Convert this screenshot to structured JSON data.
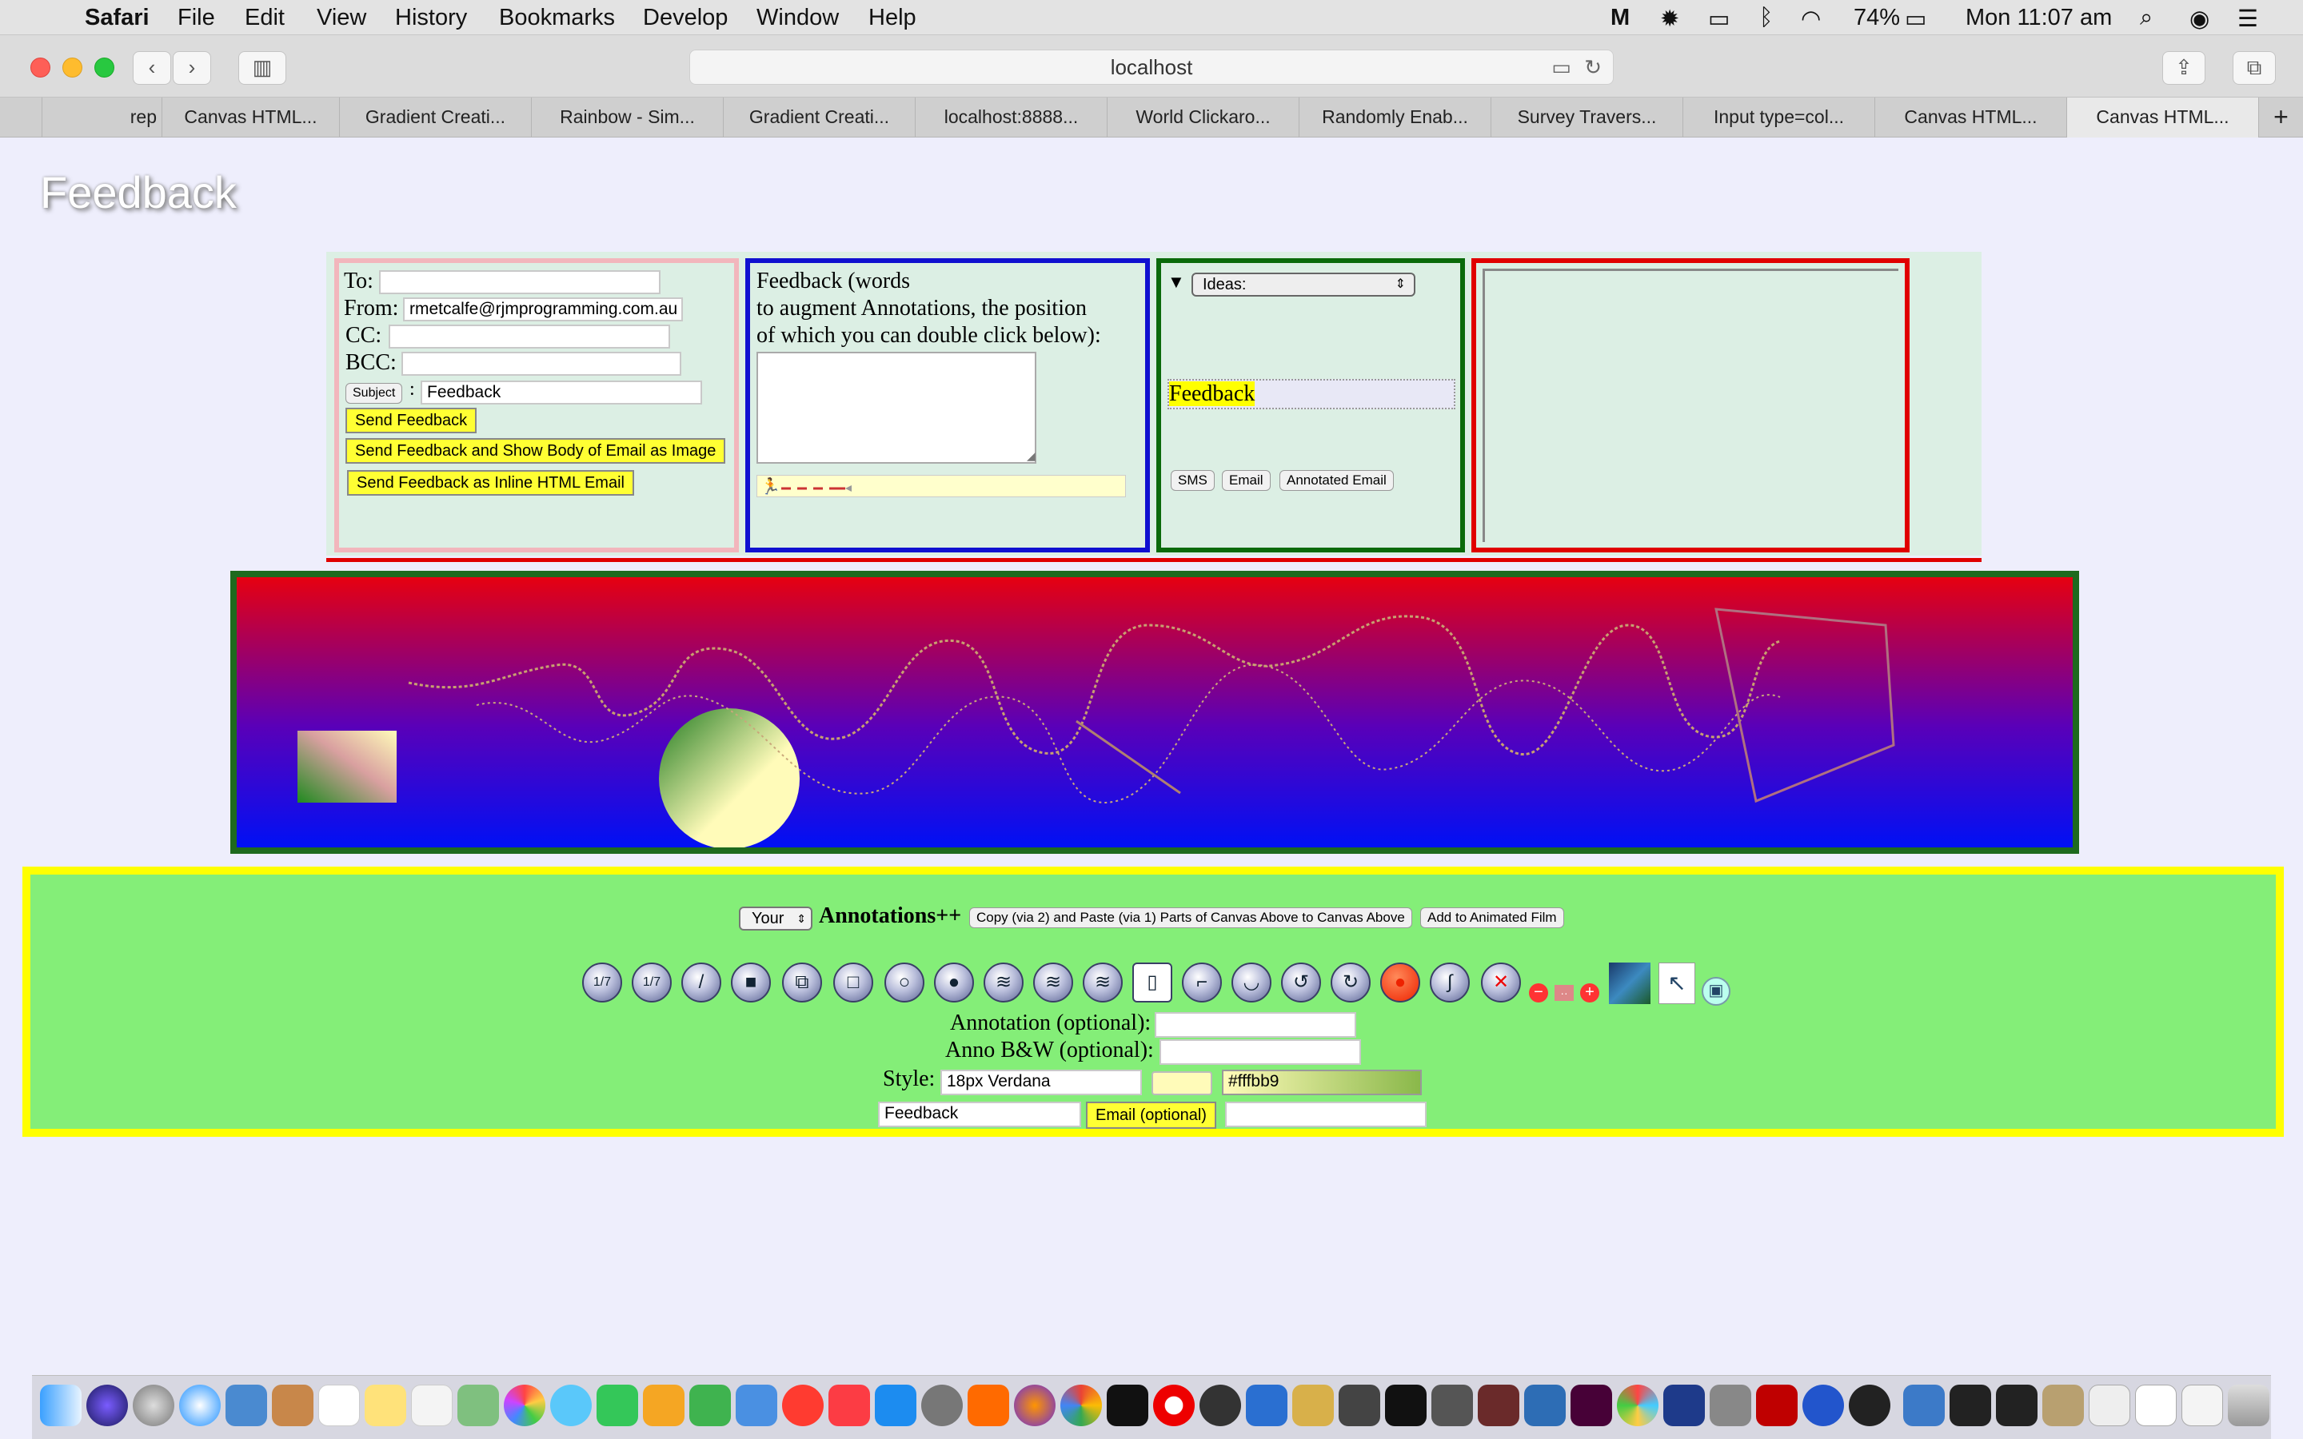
{
  "menubar": {
    "app_name": "Safari",
    "items": [
      "File",
      "Edit",
      "View",
      "History",
      "Bookmarks",
      "Develop",
      "Window",
      "Help"
    ],
    "battery": "74%",
    "clock": "Mon 11:07 am"
  },
  "browser": {
    "address": "localhost",
    "tabs": [
      "rep",
      "Canvas HTML...",
      "Gradient Creati...",
      "Rainbow - Sim...",
      "Gradient Creati...",
      "localhost:8888...",
      "World Clickaro...",
      "Randomly Enab...",
      "Survey Travers...",
      "Input type=col...",
      "Canvas HTML...",
      "Canvas HTML..."
    ],
    "new_tab": "+"
  },
  "page": {
    "title": "Feedback"
  },
  "email_panel": {
    "to_label": "To:",
    "to_value": "",
    "from_label": "From:",
    "from_value": "rmetcalfe@rjmprogramming.com.au",
    "cc_label": "CC:",
    "cc_value": "",
    "bcc_label": "BCC:",
    "bcc_value": "",
    "subject_button": "Subject",
    "subject_colon": ":",
    "subject_value": "Feedback",
    "send_feedback": "Send Feedback",
    "send_feedback_image": "Send Feedback and Show Body of Email as Image",
    "send_feedback_inline": "Send Feedback as Inline HTML Email"
  },
  "feedback_panel": {
    "line1": "Feedback (words",
    "line2": "to augment Annotations, the position",
    "line3": "of which you can double click below):",
    "textarea_value": ""
  },
  "ideas_panel": {
    "toggle": "▼",
    "select_value": "Ideas:",
    "feedback_label": "Feedback",
    "sms_button": "SMS",
    "email_button": "Email",
    "annotated_email_button": "Annotated Email"
  },
  "annotations": {
    "owner_select": "Your",
    "heading": "Annotations++",
    "copy_paste_button": "Copy (via 2) and Paste (via 1) Parts of Canvas Above to Canvas Above",
    "add_film_button": "Add to Animated Film",
    "tool_icons": [
      "1/7",
      "1/7",
      "/",
      "■",
      "⧉",
      "□",
      "○",
      "●",
      "≋",
      "≋",
      "≋",
      "▯",
      "⌐",
      "◡",
      "↺",
      "↻",
      "●",
      "∫",
      "✕"
    ],
    "annotation_label": "Annotation (optional):",
    "annotation_value": "",
    "anno_bw_label": "Anno B&W (optional):",
    "anno_bw_value": "",
    "style_label": "Style:",
    "style_value": "18px Verdana",
    "color_value": "#fffbb9",
    "feedback_value": "Feedback",
    "email_optional_button": "Email (optional)",
    "email_value": ""
  },
  "colors": {
    "accent_yellow": "#ffff33",
    "canvas_top": "#e60010",
    "canvas_bottom": "#0010f5",
    "panel_bg": "#dcefe4",
    "anno_bg": "#84ee78"
  }
}
